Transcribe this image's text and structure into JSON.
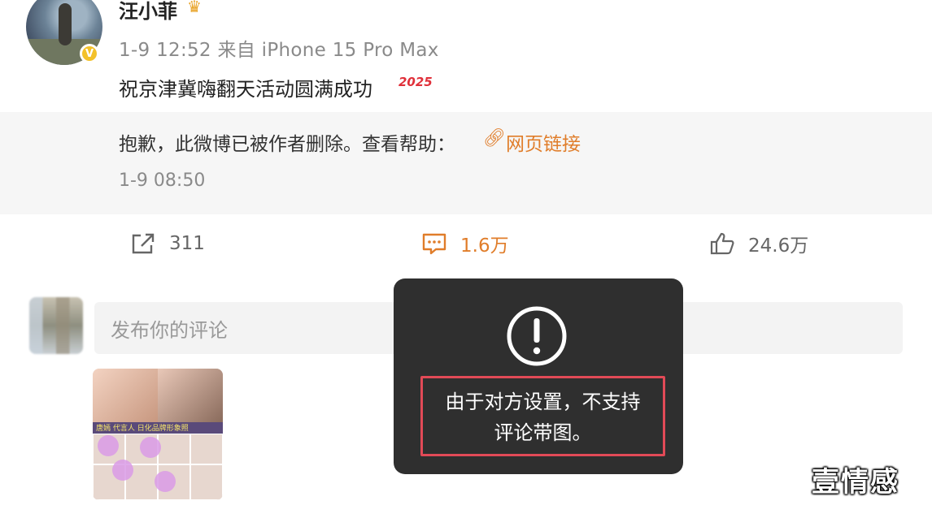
{
  "post": {
    "username": "汪小菲",
    "verified_badge": "V",
    "meta": "1-9 12:52  来自 iPhone 15 Pro Max",
    "text": "祝京津冀嗨翻天活动圆满成功",
    "year_tag": "2025"
  },
  "repost": {
    "deleted_text": "抱歉，此微博已被作者删除。查看帮助：",
    "link_label": "网页链接",
    "time": "1-9 08:50"
  },
  "actions": {
    "share_count": "311",
    "comment_count": "1.6万",
    "like_count": "24.6万"
  },
  "comment": {
    "placeholder": "发布你的评论"
  },
  "thumbnail": {
    "caption": "唐嫣 代言人 日化品牌形象照"
  },
  "toast": {
    "icon": "exclamation-circle-icon",
    "message_line1": "由于对方设置，不支持",
    "message_line2": "评论带图。"
  },
  "watermark": "壹情感",
  "colors": {
    "accent": "#e07d2a",
    "highlight_frame": "#e24a57",
    "toast_bg": "#222222"
  }
}
